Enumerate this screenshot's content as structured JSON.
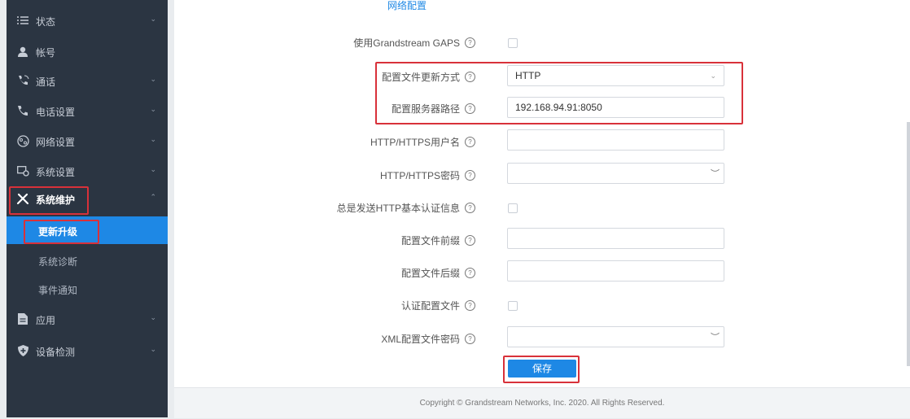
{
  "sidebar": {
    "items": [
      {
        "label": "状态",
        "icon": "list-icon",
        "has_chevron": true
      },
      {
        "label": "帐号",
        "icon": "user-icon",
        "has_chevron": false
      },
      {
        "label": "通话",
        "icon": "call-icon",
        "has_chevron": true
      },
      {
        "label": "电话设置",
        "icon": "phone-icon",
        "has_chevron": true
      },
      {
        "label": "网络设置",
        "icon": "network-icon",
        "has_chevron": true
      },
      {
        "label": "系统设置",
        "icon": "system-settings-icon",
        "has_chevron": true
      },
      {
        "label": "系统维护",
        "icon": "tools-icon",
        "has_chevron": true,
        "expanded": true
      },
      {
        "label": "应用",
        "icon": "document-icon",
        "has_chevron": true
      },
      {
        "label": "设备检测",
        "icon": "shield-icon",
        "has_chevron": true
      }
    ],
    "sub_items": [
      {
        "label": "更新升级",
        "selected": true
      },
      {
        "label": "系统诊断",
        "selected": false
      },
      {
        "label": "事件通知",
        "selected": false
      }
    ]
  },
  "main": {
    "section_title": "网络配置",
    "fields": {
      "gaps": {
        "label": "使用Grandstream GAPS",
        "checked": false
      },
      "upgrade_method": {
        "label": "配置文件更新方式",
        "value": "HTTP"
      },
      "server_path": {
        "label": "配置服务器路径",
        "value": "192.168.94.91:8050"
      },
      "http_user": {
        "label": "HTTP/HTTPS用户名",
        "value": ""
      },
      "http_password": {
        "label": "HTTP/HTTPS密码",
        "value": ""
      },
      "always_auth": {
        "label": "总是发送HTTP基本认证信息",
        "checked": false
      },
      "prefix": {
        "label": "配置文件前缀",
        "value": ""
      },
      "postfix": {
        "label": "配置文件后缀",
        "value": ""
      },
      "auth_config": {
        "label": "认证配置文件",
        "checked": false
      },
      "xml_password": {
        "label": "XML配置文件密码",
        "value": ""
      }
    },
    "save_label": "保存"
  },
  "footer": {
    "copyright": "Copyright © Grandstream Networks, Inc. 2020. All Rights Reserved."
  },
  "colors": {
    "accent": "#1e88e5",
    "sidebar_bg": "#2b3542",
    "highlight": "#d8313a"
  }
}
